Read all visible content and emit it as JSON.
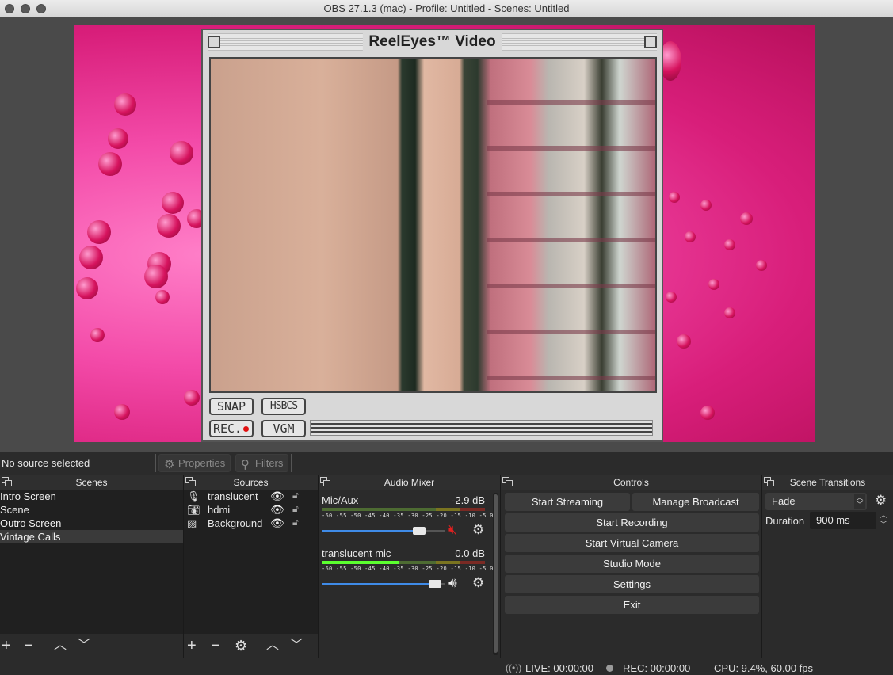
{
  "window": {
    "title": "OBS 27.1.3 (mac) - Profile: Untitled - Scenes: Untitled"
  },
  "preview": {
    "overlay_title": "ReelEyes™ Video",
    "buttons": {
      "snap": "SNAP",
      "hsbcs": "HSBCS",
      "rec": "REC.",
      "vgm": "VGM"
    }
  },
  "source_toolbar": {
    "status": "No source selected",
    "properties": "Properties",
    "filters": "Filters"
  },
  "scenes": {
    "title": "Scenes",
    "items": [
      {
        "label": "Intro Screen",
        "selected": false
      },
      {
        "label": "Scene",
        "selected": false
      },
      {
        "label": "Outro Screen",
        "selected": false
      },
      {
        "label": "Vintage Calls",
        "selected": true
      }
    ]
  },
  "sources": {
    "title": "Sources",
    "items": [
      {
        "label": "translucent",
        "icon": "microphone-icon"
      },
      {
        "label": "hdmi",
        "icon": "camera-icon"
      },
      {
        "label": "Background",
        "icon": "image-icon"
      }
    ]
  },
  "audio_mixer": {
    "title": "Audio Mixer",
    "ticks": "-60 -55 -50 -45 -40 -35 -30 -25 -20 -15 -10 -5  0",
    "channels": [
      {
        "name": "Mic/Aux",
        "db": "-2.9 dB",
        "muted": true,
        "volume": 0.83,
        "level": 0
      },
      {
        "name": "translucent mic",
        "db": "0.0 dB",
        "muted": false,
        "volume": 0.97,
        "level": 0.47
      }
    ]
  },
  "controls": {
    "title": "Controls",
    "start_streaming": "Start Streaming",
    "manage_broadcast": "Manage Broadcast",
    "start_recording": "Start Recording",
    "start_virtual_camera": "Start Virtual Camera",
    "studio_mode": "Studio Mode",
    "settings": "Settings",
    "exit": "Exit"
  },
  "scene_transitions": {
    "title": "Scene Transitions",
    "selected": "Fade",
    "duration_label": "Duration",
    "duration_value": "900 ms"
  },
  "statusbar": {
    "live": "LIVE: 00:00:00",
    "rec": "REC: 00:00:00",
    "cpu": "CPU: 9.4%, 60.00 fps"
  },
  "colors": {
    "accent": "#3f8be8",
    "muted": "#e02020",
    "canvas_pink": "#e9318f"
  }
}
